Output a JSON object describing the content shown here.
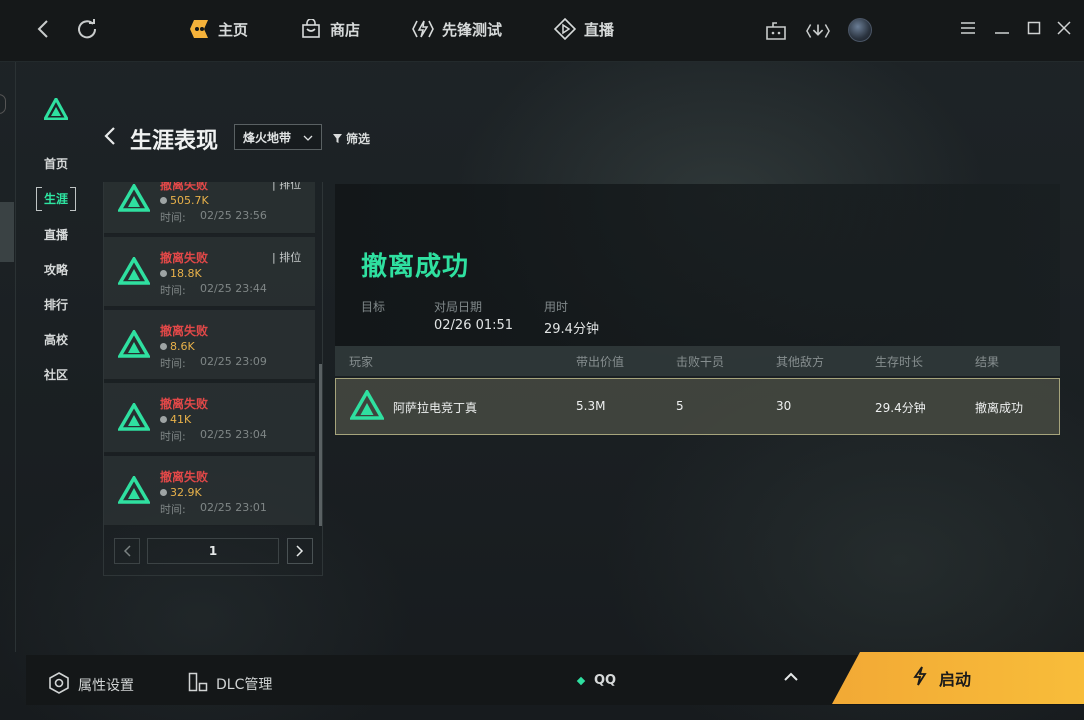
{
  "colors": {
    "accent": "#2fe0a0",
    "fail": "#e24848",
    "value": "#e8b14a",
    "launch": "#f5b23a"
  },
  "topbar": {
    "nav": [
      {
        "label": "主页",
        "icon": "home-brand-icon"
      },
      {
        "label": "商店",
        "icon": "shop-bag-icon"
      },
      {
        "label": "先锋测试",
        "icon": "lightning-badge-icon"
      },
      {
        "label": "直播",
        "icon": "live-diamond-icon"
      }
    ]
  },
  "sidebar": {
    "items": [
      {
        "label": "首页"
      },
      {
        "label": "生涯",
        "active": true
      },
      {
        "label": "直播"
      },
      {
        "label": "攻略"
      },
      {
        "label": "排行"
      },
      {
        "label": "高校"
      },
      {
        "label": "社区"
      }
    ]
  },
  "header": {
    "title": "生涯表现",
    "mode": "烽火地带",
    "filter": "筛选"
  },
  "matches": [
    {
      "result": "撤离失败",
      "tag": "| 排位",
      "value": "505.7K",
      "time_label": "时间:",
      "time": "02/25 23:56"
    },
    {
      "result": "撤离失败",
      "tag": "| 排位",
      "value": "18.8K",
      "time_label": "时间:",
      "time": "02/25 23:44"
    },
    {
      "result": "撤离失败",
      "tag": "",
      "value": "8.6K",
      "time_label": "时间:",
      "time": "02/25 23:09"
    },
    {
      "result": "撤离失败",
      "tag": "",
      "value": "41K",
      "time_label": "时间:",
      "time": "02/25 23:04"
    },
    {
      "result": "撤离失败",
      "tag": "",
      "value": "32.9K",
      "time_label": "时间:",
      "time": "02/25 23:01"
    }
  ],
  "pager": {
    "page": "1"
  },
  "detail": {
    "status": "撤离成功",
    "meta": [
      {
        "label": "目标",
        "value": ""
      },
      {
        "label": "对局日期",
        "value": "02/26 01:51"
      },
      {
        "label": "用时",
        "value": "29.4分钟"
      }
    ],
    "columns": [
      "玩家",
      "带出价值",
      "击败干员",
      "其他敌方",
      "生存时长",
      "结果"
    ],
    "row": {
      "player": "阿萨拉电竞丁真",
      "value": "5.3M",
      "kills": "5",
      "others": "30",
      "survival": "29.4分钟",
      "result": "撤离成功"
    }
  },
  "bottombar": {
    "settings": "属性设置",
    "dlc": "DLC管理",
    "account": "QQ",
    "launch": "启动"
  }
}
